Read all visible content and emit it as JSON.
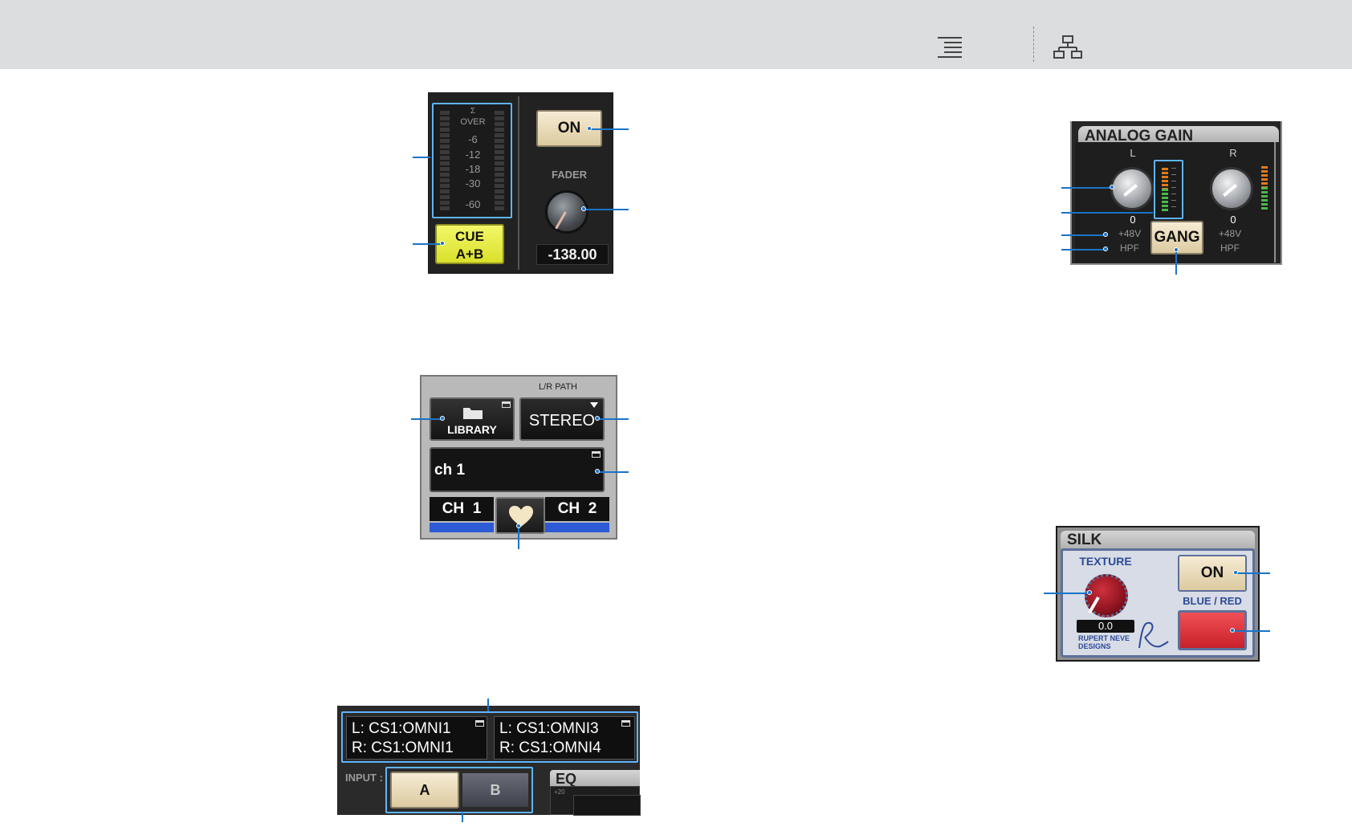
{
  "meter_fader": {
    "scale": [
      "Σ",
      "OVER",
      "-6",
      "-12",
      "-18",
      "-30",
      "-60"
    ],
    "on_label": "ON",
    "fader_label": "FADER",
    "fader_value": "-138.00",
    "cue_line1": "CUE",
    "cue_line2": "A+B"
  },
  "analog_gain": {
    "title": "ANALOG GAIN",
    "left_label": "L",
    "right_label": "R",
    "left_value": "0",
    "right_value": "0",
    "left_phantom": "+48V",
    "left_hpf": "HPF",
    "right_phantom": "+48V",
    "right_hpf": "HPF",
    "gang_label": "GANG"
  },
  "library_panel": {
    "lr_path_label": "L/R PATH",
    "library_label": "LIBRARY",
    "stereo_label": "STEREO",
    "channel_name": "ch 1",
    "ch_left": "CH  1",
    "ch_right": "CH  2"
  },
  "silk": {
    "title": "SILK",
    "texture_label": "TEXTURE",
    "texture_value": "0.0",
    "brand_line1": "RUPERT NEVE",
    "brand_line2": "DESIGNS",
    "on_label": "ON",
    "blue_red_label": "BLUE / RED"
  },
  "input_patch": {
    "a_line1": "L: CS1:OMNI1",
    "a_line2": "R: CS1:OMNI1",
    "b_line1": "L: CS1:OMNI3",
    "b_line2": "R: CS1:OMNI4",
    "input_label": "INPUT :",
    "a_button": "A",
    "b_button": "B",
    "eq_label": "EQ",
    "eq_axis": "+20"
  },
  "colors": {
    "callout": "#1a73c8",
    "highlight": "#5fb4ff",
    "cue_yellow": "#e8f03a",
    "texture_red": "#9c1a24",
    "blue_red_button": "#e2333a",
    "channel_blue": "#2d5bd6"
  },
  "icons": {
    "toc": "list-indent-icon",
    "structure": "hierarchy-icon",
    "folder": "folder-icon",
    "popup": "popup-window-icon",
    "heart": "heart-icon",
    "dropdown": "triangle-down-icon"
  }
}
